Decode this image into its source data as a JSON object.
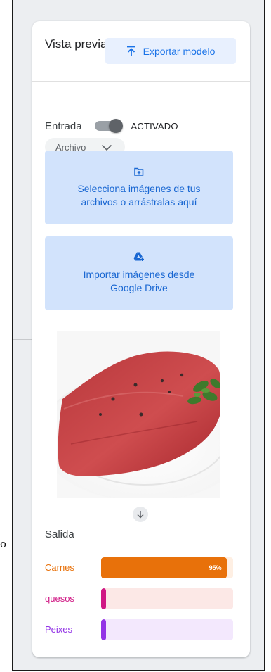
{
  "panel": {
    "title": "Vista previa",
    "export_label": "Exportar modelo"
  },
  "input": {
    "label": "Entrada",
    "toggle_state": "ACTIVADO",
    "toggle_on": true,
    "source": "Archivo"
  },
  "upload": {
    "files_text": "Selecciona imágenes de tus archivos o arrástralas aquí",
    "drive_text": "Importar imágenes desde Google Drive"
  },
  "preview": {
    "image": "raw beef steak with peppercorns and parsley on a white plate"
  },
  "output": {
    "label": "Salida",
    "classes": [
      {
        "name": "Carnes",
        "percent": 95,
        "percent_label": "95%",
        "color": "#e8710a",
        "track": "#feefe3"
      },
      {
        "name": "quesos",
        "percent": 0,
        "percent_label": "",
        "color": "#d01884",
        "track": "#fce8e6"
      },
      {
        "name": "Peixes",
        "percent": 0,
        "percent_label": "",
        "color": "#9334e6",
        "track": "#f3e8fd"
      }
    ]
  },
  "page": {
    "stray_text": "o"
  },
  "icons": {
    "export": "upload-icon",
    "folder": "folder-add-icon",
    "drive": "google-drive-add-icon",
    "chevron": "chevron-down-icon",
    "arrow": "arrow-down-icon"
  }
}
